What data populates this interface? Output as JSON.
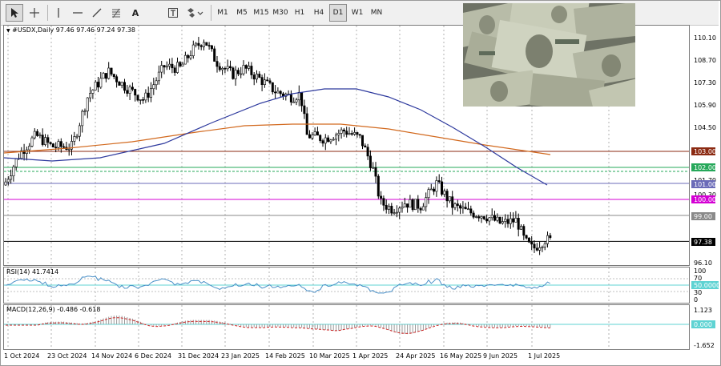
{
  "toolbar": {
    "tools": [
      "cursor-tool",
      "crosshair-tool",
      "vertical-line-tool",
      "horizontal-line-tool",
      "trendline-tool",
      "fibonacci-tool",
      "text-tool",
      "text-label-tool",
      "shapes-tool"
    ],
    "timeframes": [
      "M1",
      "M5",
      "M15",
      "M30",
      "H1",
      "H4",
      "D1",
      "W1",
      "MN"
    ],
    "active_timeframe": "D1"
  },
  "main": {
    "header": "#USDX,Daily  97.46 97.46 97.24 97.38",
    "price_axis": [
      "110.10",
      "108.70",
      "107.30",
      "105.90",
      "104.50",
      "101.70",
      "100.30",
      "98.90",
      "97.50",
      "96.10"
    ],
    "levels": [
      {
        "price": 103.0,
        "label": "103.00",
        "color": "#8b2a12"
      },
      {
        "price": 102.0,
        "label": "102.00",
        "color": "#26a85a"
      },
      {
        "price": 101.0,
        "label": "101.00",
        "color": "#6b6bb8"
      },
      {
        "price": 100.0,
        "label": "100.00",
        "color": "#d400d4"
      },
      {
        "price": 99.0,
        "label": "99.00",
        "color": "#8a8a8a"
      },
      {
        "price": 97.38,
        "label": "97.38",
        "color": "#000000"
      }
    ],
    "last_price_label": "97.38",
    "photo_description": "dollars-image"
  },
  "rsi": {
    "header": "RSI(14) 41.7414",
    "axis": [
      "100",
      "70",
      "30",
      "0"
    ],
    "value_tag": "50.0000"
  },
  "macd": {
    "header": "MACD(12,26,9) -0.486 -0.618",
    "axis": [
      "1.123",
      "-1.652"
    ],
    "value_tag": "0.000"
  },
  "dates": [
    "1 Oct 2024",
    "23 Oct 2024",
    "14 Nov 2024",
    "6 Dec 2024",
    "31 Dec 2024",
    "23 Jan 2025",
    "14 Feb 2025",
    "10 Mar 2025",
    "1 Apr 2025",
    "24 Apr 2025",
    "16 May 2025",
    "9 Jun 2025",
    "1 Jul 2025"
  ],
  "colors": {
    "ma_blue": "#2e3a9e",
    "ma_orange": "#d2691e",
    "rsi_line": "#4a90c8",
    "macd_signal": "#cc2222",
    "hist": "#9a9a9a"
  }
}
